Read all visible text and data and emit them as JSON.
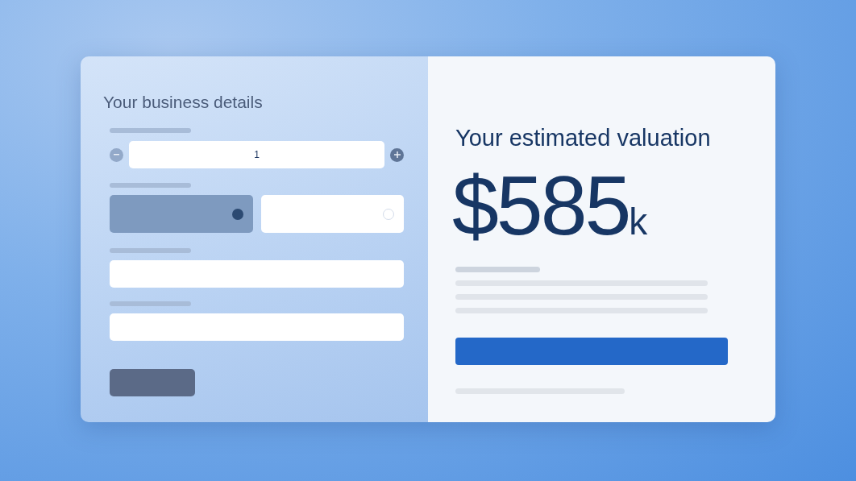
{
  "form": {
    "title": "Your business details",
    "quantity": {
      "value": "1"
    },
    "options": [
      {
        "selected": true
      },
      {
        "selected": false
      }
    ]
  },
  "result": {
    "title": "Your estimated valuation",
    "amount": "$585",
    "unit": "k"
  }
}
